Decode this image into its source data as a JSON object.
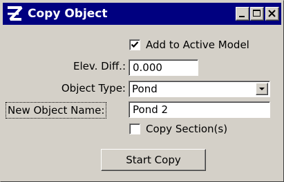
{
  "window": {
    "title": "Copy Object",
    "icon": "app-logo-icon",
    "controls": [
      "minimize-icon",
      "maximize-icon",
      "close-icon"
    ]
  },
  "form": {
    "add_to_active": {
      "label": "Add to Active Model",
      "checked": true
    },
    "elev_diff": {
      "label": "Elev. Diff.:",
      "value": "0.000"
    },
    "object_type": {
      "label": "Object Type:",
      "value": "Pond"
    },
    "new_object_name": {
      "label": "New Object Name:",
      "value": "Pond 2"
    },
    "copy_sections": {
      "label": "Copy Section(s)",
      "checked": false
    },
    "start_button": {
      "label": "Start Copy"
    }
  },
  "colors": {
    "titlebar": "#000080",
    "face": "#d4d0c8"
  }
}
